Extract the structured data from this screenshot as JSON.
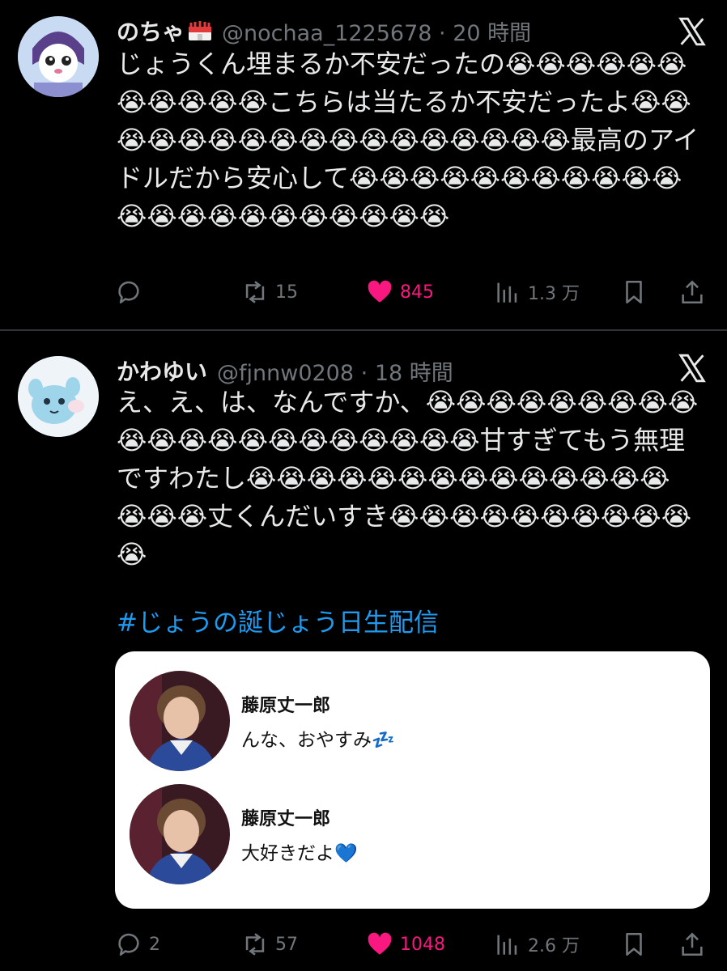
{
  "tweets": [
    {
      "display_name": "のちゃ",
      "handle": "@nochaa_1225678",
      "time": "20 時間",
      "text": "じょうくん埋まるか不安だったの😭😭😭😭😭😭😭😭😭😭😭こちらは当たるか不安だったよ😭😭😭😭😭😭😭😭😭😭😭😭😭😭😭😭😭最高のアイドルだから安心して😭😭😭😭😭😭😭😭😭😭😭😭😭😭😭😭😭😭😭😭😭😭",
      "actions": {
        "reply": "",
        "retweet": "15",
        "like": "845",
        "views": "1.3 万"
      }
    },
    {
      "display_name": "かわゆい",
      "handle": "@fjnnw0208",
      "time": "18 時間",
      "text": "え、え、は、なんですか、😭😭😭😭😭😭😭😭😭😭😭😭😭😭😭😭😭😭😭😭😭甘すぎてもう無理ですわたし😭😭😭😭😭😭😭😭😭😭😭😭😭😭😭😭😭丈くんだいすき😭😭😭😭😭😭😭😭😭😭😭",
      "hashtag": "#じょうの誕じょう日生配信",
      "embed": {
        "messages": [
          {
            "name": "藤原丈一郎",
            "text": "んな、おやすみ💤"
          },
          {
            "name": "藤原丈一郎",
            "text": "大好きだよ💙"
          }
        ]
      },
      "actions": {
        "reply": "2",
        "retweet": "57",
        "like": "1048",
        "views": "2.6 万"
      }
    }
  ],
  "colors": {
    "background": "#000000",
    "text": "#e7e9ea",
    "muted": "#71767b",
    "link": "#1d9bf0",
    "like": "#f91880",
    "divider": "#2f3336"
  },
  "icons": {
    "badge": "school-building-badge-icon",
    "platform": "x-logo-icon",
    "reply": "reply-bubble-icon",
    "retweet": "retweet-icon",
    "like": "heart-filled-icon",
    "views": "views-bar-chart-icon",
    "bookmark": "bookmark-icon",
    "share": "share-upload-icon"
  }
}
